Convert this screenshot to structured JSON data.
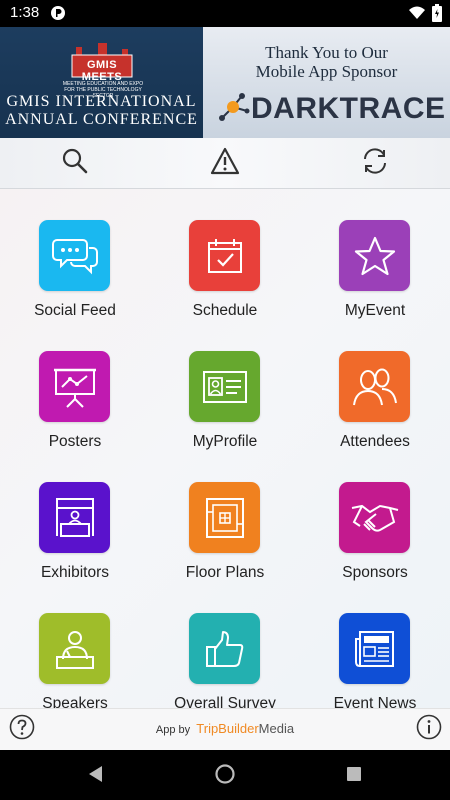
{
  "status_bar": {
    "time": "1:38"
  },
  "banner": {
    "logo_text": "GMIS MEETS",
    "logo_tagline": "MEETING EDUCATION AND EXPO FOR THE PUBLIC TECHNOLOGY SECTOR",
    "conference_line1": "GMIS INTERNATIONAL",
    "conference_line2": "ANNUAL CONFERENCE",
    "sponsor_line1": "Thank You to Our",
    "sponsor_line2": "Mobile App Sponsor",
    "sponsor_name": "DARKTRACE"
  },
  "toolbar": {
    "icons": [
      "search-icon",
      "alert-icon",
      "refresh-icon"
    ]
  },
  "tiles": [
    {
      "label": "Social Feed",
      "icon": "chat-bubbles-icon",
      "color": "#1ab8f0"
    },
    {
      "label": "Schedule",
      "icon": "calendar-check-icon",
      "color": "#e8403a"
    },
    {
      "label": "MyEvent",
      "icon": "star-icon",
      "color": "#9b40b8"
    },
    {
      "label": "Posters",
      "icon": "presentation-board-icon",
      "color": "#c01ab0"
    },
    {
      "label": "MyProfile",
      "icon": "id-card-icon",
      "color": "#66a82e"
    },
    {
      "label": "Attendees",
      "icon": "people-icon",
      "color": "#f06a2a"
    },
    {
      "label": "Exhibitors",
      "icon": "booth-icon",
      "color": "#5a12cc"
    },
    {
      "label": "Floor Plans",
      "icon": "floor-plan-icon",
      "color": "#f0811f"
    },
    {
      "label": "Sponsors",
      "icon": "handshake-icon",
      "color": "#c31a8e"
    },
    {
      "label": "Speakers",
      "icon": "speaker-podium-icon",
      "color": "#9fbd2a"
    },
    {
      "label": "Overall Survey",
      "icon": "thumbs-up-icon",
      "color": "#23b0b0"
    },
    {
      "label": "Event News",
      "icon": "newspaper-icon",
      "color": "#0f4fd6"
    }
  ],
  "footer": {
    "app_by": "App by",
    "brand_primary": "TripBuilder",
    "brand_secondary": "Media"
  }
}
